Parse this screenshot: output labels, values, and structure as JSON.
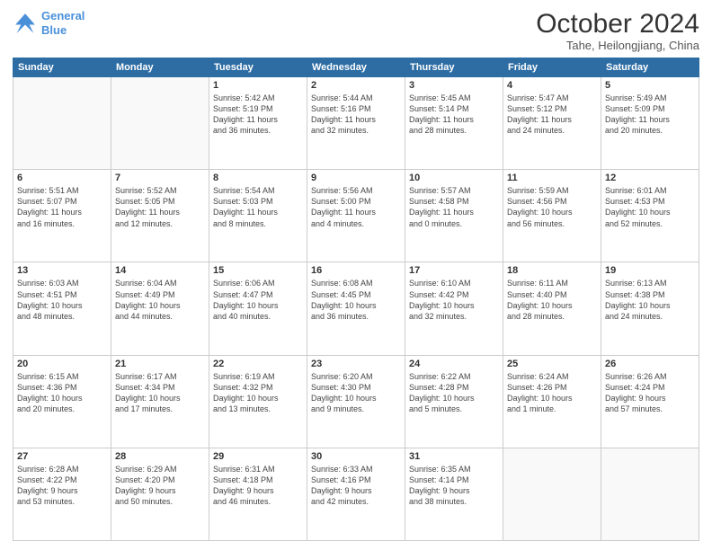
{
  "header": {
    "logo_line1": "General",
    "logo_line2": "Blue",
    "title": "October 2024",
    "location": "Tahe, Heilongjiang, China"
  },
  "weekdays": [
    "Sunday",
    "Monday",
    "Tuesday",
    "Wednesday",
    "Thursday",
    "Friday",
    "Saturday"
  ],
  "weeks": [
    [
      {
        "day": "",
        "info": ""
      },
      {
        "day": "",
        "info": ""
      },
      {
        "day": "1",
        "info": "Sunrise: 5:42 AM\nSunset: 5:19 PM\nDaylight: 11 hours\nand 36 minutes."
      },
      {
        "day": "2",
        "info": "Sunrise: 5:44 AM\nSunset: 5:16 PM\nDaylight: 11 hours\nand 32 minutes."
      },
      {
        "day": "3",
        "info": "Sunrise: 5:45 AM\nSunset: 5:14 PM\nDaylight: 11 hours\nand 28 minutes."
      },
      {
        "day": "4",
        "info": "Sunrise: 5:47 AM\nSunset: 5:12 PM\nDaylight: 11 hours\nand 24 minutes."
      },
      {
        "day": "5",
        "info": "Sunrise: 5:49 AM\nSunset: 5:09 PM\nDaylight: 11 hours\nand 20 minutes."
      }
    ],
    [
      {
        "day": "6",
        "info": "Sunrise: 5:51 AM\nSunset: 5:07 PM\nDaylight: 11 hours\nand 16 minutes."
      },
      {
        "day": "7",
        "info": "Sunrise: 5:52 AM\nSunset: 5:05 PM\nDaylight: 11 hours\nand 12 minutes."
      },
      {
        "day": "8",
        "info": "Sunrise: 5:54 AM\nSunset: 5:03 PM\nDaylight: 11 hours\nand 8 minutes."
      },
      {
        "day": "9",
        "info": "Sunrise: 5:56 AM\nSunset: 5:00 PM\nDaylight: 11 hours\nand 4 minutes."
      },
      {
        "day": "10",
        "info": "Sunrise: 5:57 AM\nSunset: 4:58 PM\nDaylight: 11 hours\nand 0 minutes."
      },
      {
        "day": "11",
        "info": "Sunrise: 5:59 AM\nSunset: 4:56 PM\nDaylight: 10 hours\nand 56 minutes."
      },
      {
        "day": "12",
        "info": "Sunrise: 6:01 AM\nSunset: 4:53 PM\nDaylight: 10 hours\nand 52 minutes."
      }
    ],
    [
      {
        "day": "13",
        "info": "Sunrise: 6:03 AM\nSunset: 4:51 PM\nDaylight: 10 hours\nand 48 minutes."
      },
      {
        "day": "14",
        "info": "Sunrise: 6:04 AM\nSunset: 4:49 PM\nDaylight: 10 hours\nand 44 minutes."
      },
      {
        "day": "15",
        "info": "Sunrise: 6:06 AM\nSunset: 4:47 PM\nDaylight: 10 hours\nand 40 minutes."
      },
      {
        "day": "16",
        "info": "Sunrise: 6:08 AM\nSunset: 4:45 PM\nDaylight: 10 hours\nand 36 minutes."
      },
      {
        "day": "17",
        "info": "Sunrise: 6:10 AM\nSunset: 4:42 PM\nDaylight: 10 hours\nand 32 minutes."
      },
      {
        "day": "18",
        "info": "Sunrise: 6:11 AM\nSunset: 4:40 PM\nDaylight: 10 hours\nand 28 minutes."
      },
      {
        "day": "19",
        "info": "Sunrise: 6:13 AM\nSunset: 4:38 PM\nDaylight: 10 hours\nand 24 minutes."
      }
    ],
    [
      {
        "day": "20",
        "info": "Sunrise: 6:15 AM\nSunset: 4:36 PM\nDaylight: 10 hours\nand 20 minutes."
      },
      {
        "day": "21",
        "info": "Sunrise: 6:17 AM\nSunset: 4:34 PM\nDaylight: 10 hours\nand 17 minutes."
      },
      {
        "day": "22",
        "info": "Sunrise: 6:19 AM\nSunset: 4:32 PM\nDaylight: 10 hours\nand 13 minutes."
      },
      {
        "day": "23",
        "info": "Sunrise: 6:20 AM\nSunset: 4:30 PM\nDaylight: 10 hours\nand 9 minutes."
      },
      {
        "day": "24",
        "info": "Sunrise: 6:22 AM\nSunset: 4:28 PM\nDaylight: 10 hours\nand 5 minutes."
      },
      {
        "day": "25",
        "info": "Sunrise: 6:24 AM\nSunset: 4:26 PM\nDaylight: 10 hours\nand 1 minute."
      },
      {
        "day": "26",
        "info": "Sunrise: 6:26 AM\nSunset: 4:24 PM\nDaylight: 9 hours\nand 57 minutes."
      }
    ],
    [
      {
        "day": "27",
        "info": "Sunrise: 6:28 AM\nSunset: 4:22 PM\nDaylight: 9 hours\nand 53 minutes."
      },
      {
        "day": "28",
        "info": "Sunrise: 6:29 AM\nSunset: 4:20 PM\nDaylight: 9 hours\nand 50 minutes."
      },
      {
        "day": "29",
        "info": "Sunrise: 6:31 AM\nSunset: 4:18 PM\nDaylight: 9 hours\nand 46 minutes."
      },
      {
        "day": "30",
        "info": "Sunrise: 6:33 AM\nSunset: 4:16 PM\nDaylight: 9 hours\nand 42 minutes."
      },
      {
        "day": "31",
        "info": "Sunrise: 6:35 AM\nSunset: 4:14 PM\nDaylight: 9 hours\nand 38 minutes."
      },
      {
        "day": "",
        "info": ""
      },
      {
        "day": "",
        "info": ""
      }
    ]
  ]
}
